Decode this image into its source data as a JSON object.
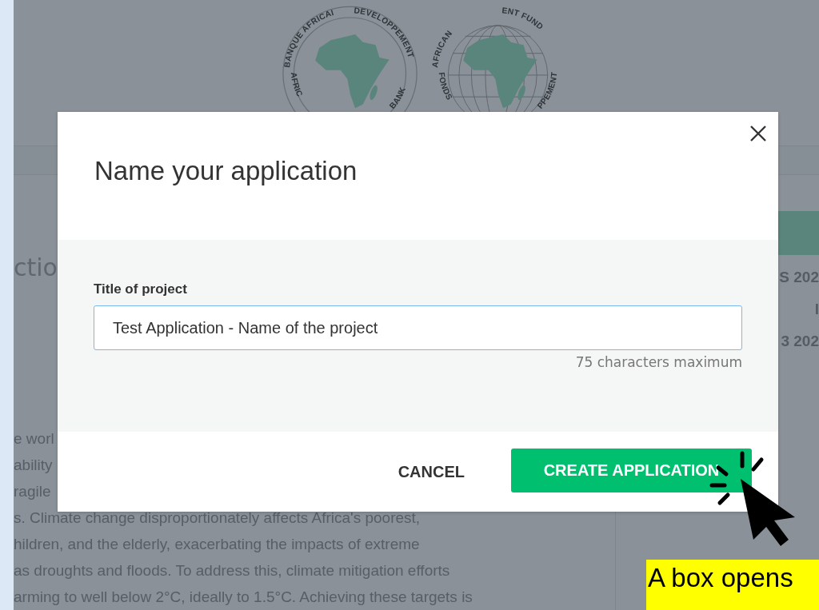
{
  "page": {
    "logos": [
      {
        "top_texts": [
          "BANQUE AFRICAI",
          "DEVELOPPEMENT"
        ],
        "bottom_texts": [
          "AFRIC",
          "BANK"
        ],
        "kind": "seal"
      },
      {
        "top_texts": [
          "AFRICAN",
          "ENT FUND"
        ],
        "bottom_texts": [
          "FONDS",
          "PPEMENT"
        ],
        "kind": "globe"
      }
    ],
    "heading": "ctio",
    "paragraph_lines": [
      "e worl",
      "ability",
      "ragile",
      "s. Climate change disproportionately affects Africa's poorest,",
      "hildren, and the elderly, exacerbating the impacts of extreme",
      "as droughts and floods. To address this, climate mitigation efforts",
      "arming to well below 2°C, ideally to 1.5°C. Achieving these targets is"
    ],
    "side_lines": [
      "S 202",
      "I",
      "3 202"
    ]
  },
  "dialog": {
    "title": "Name your application",
    "field": {
      "label": "Title of project",
      "value": "Test Application - Name of the project",
      "hint": "75 characters maximum",
      "focused": true
    },
    "buttons": [
      {
        "label": "CANCEL",
        "kind": "text"
      },
      {
        "label": "CREATE APPLICATION",
        "kind": "primary"
      }
    ]
  },
  "annotation": {
    "text": "A box opens"
  }
}
